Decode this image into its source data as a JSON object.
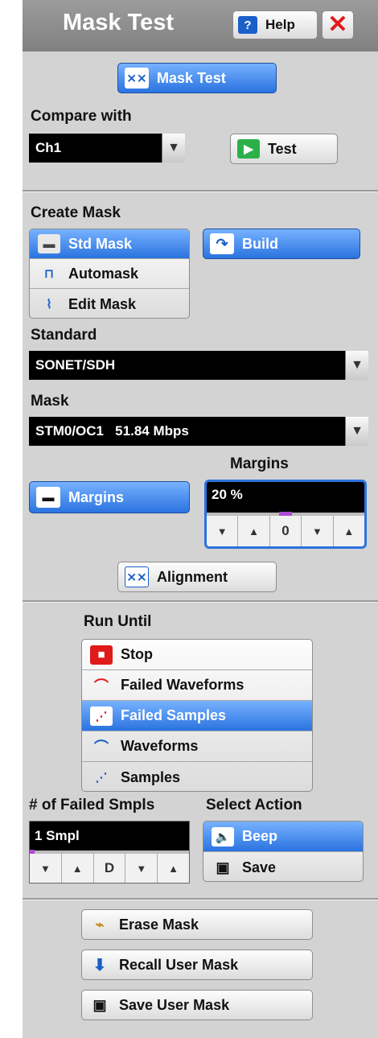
{
  "header": {
    "title": "Mask Test",
    "help_label": "Help"
  },
  "mask_test_button": "Mask Test",
  "compare": {
    "label": "Compare with",
    "value": "Ch1",
    "test_label": "Test"
  },
  "create_mask": {
    "label": "Create Mask",
    "options": [
      "Std Mask",
      "Automask",
      "Edit Mask"
    ],
    "selected": "Std Mask",
    "build_label": "Build"
  },
  "standard": {
    "label": "Standard",
    "value": "SONET/SDH"
  },
  "mask": {
    "label": "Mask",
    "value": "STM0/OC1   51.84 Mbps"
  },
  "margins": {
    "button_label": "Margins",
    "heading": "Margins",
    "value": "20 %",
    "stepper_mid": "0"
  },
  "alignment_label": "Alignment",
  "run_until": {
    "label": "Run Until",
    "options": [
      "Stop",
      "Failed Waveforms",
      "Failed Samples",
      "Waveforms",
      "Samples"
    ],
    "selected": "Failed Samples"
  },
  "failed_smpls": {
    "label": "# of Failed Smpls",
    "value": "1 Smpl",
    "stepper_mid": "D"
  },
  "select_action": {
    "label": "Select Action",
    "options": [
      "Beep",
      "Save"
    ],
    "selected": "Beep"
  },
  "bottom_buttons": {
    "erase": "Erase Mask",
    "recall": "Recall User Mask",
    "save": "Save User Mask"
  },
  "colors": {
    "accent": "#2a73e0",
    "panel": "#d3d3d3",
    "title": "#808080"
  }
}
